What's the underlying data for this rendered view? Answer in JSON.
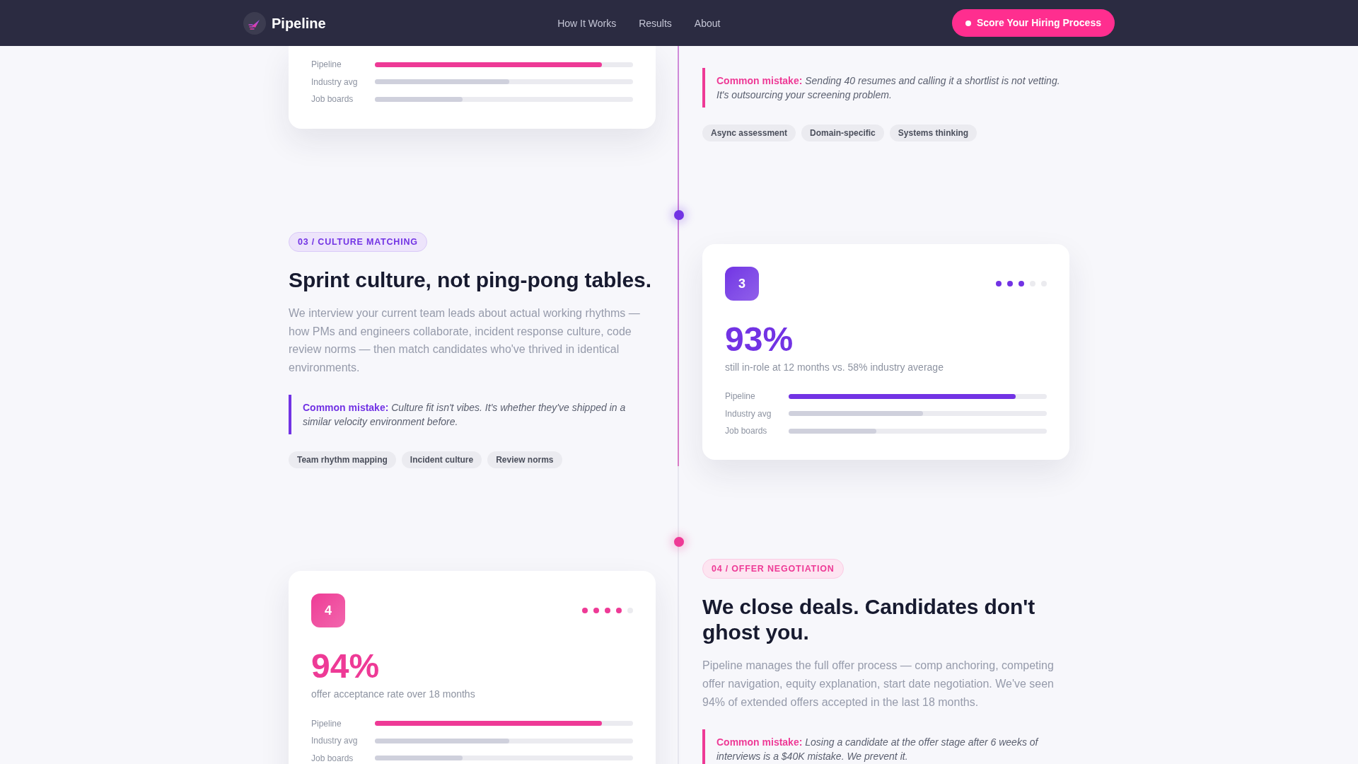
{
  "nav": {
    "brand": "Pipeline",
    "links": [
      "How It Works",
      "Results",
      "About"
    ],
    "cta": "Score Your Hiring Process"
  },
  "steps": [
    {
      "kind": "partial",
      "color": "#ee3a96",
      "card": {
        "bars": [
          {
            "label": "Pipeline",
            "level": 0.88,
            "highlight": true
          },
          {
            "label": "Industry avg",
            "level": 0.52,
            "highlight": false
          },
          {
            "label": "Job boards",
            "level": 0.34,
            "highlight": false
          }
        ]
      },
      "text": {
        "mistake": "**Common mistake:** Sending 40 resumes and calling it a shortlist is not vetting. It's outsourcing your screening problem.",
        "tags": [
          "Async assessment",
          "Domain-specific",
          "Systems thinking"
        ]
      }
    },
    {
      "kind": "full",
      "color": "#7233e4",
      "text": {
        "label": "03 / CULTURE MATCHING",
        "heading": "Sprint culture, not ping-pong tables.",
        "body": "We interview your current team leads about actual working rhythms — how PMs and engineers collaborate, incident response culture, code review norms — then match candidates who've thrived in identical environments.",
        "mistake": "**Common mistake:** Culture fit isn't vibes. It's whether they've shipped in a similar velocity environment before.",
        "tags": [
          "Team rhythm mapping",
          "Incident culture",
          "Review norms"
        ]
      },
      "card": {
        "number": "3",
        "stars": 3,
        "stat": "93%",
        "caption": "still in-role at 12 months vs. 58% industry average",
        "bars": [
          {
            "label": "Pipeline",
            "level": 0.88,
            "highlight": true
          },
          {
            "label": "Industry avg",
            "level": 0.52,
            "highlight": false
          },
          {
            "label": "Job boards",
            "level": 0.34,
            "highlight": false
          }
        ]
      }
    },
    {
      "kind": "full",
      "color": "#ee3a96",
      "text": {
        "label": "04 / OFFER NEGOTIATION",
        "heading": "We close deals. Candidates don't ghost you.",
        "body": "Pipeline manages the full offer process — comp anchoring, competing offer navigation, equity explanation, start date negotiation. We've seen 94% of extended offers accepted in the last 18 months.",
        "mistake": "**Common mistake:** Losing a candidate at the offer stage after 6 weeks of interviews is a $40K mistake. We prevent it."
      },
      "card": {
        "number": "4",
        "stars": 4,
        "stat": "94%",
        "caption": "offer acceptance rate over 18 months",
        "bars": [
          {
            "label": "Pipeline",
            "level": 0.88,
            "highlight": true
          },
          {
            "label": "Industry avg",
            "level": 0.52,
            "highlight": false
          },
          {
            "label": "Job boards",
            "level": 0.34,
            "highlight": false
          }
        ]
      }
    }
  ]
}
